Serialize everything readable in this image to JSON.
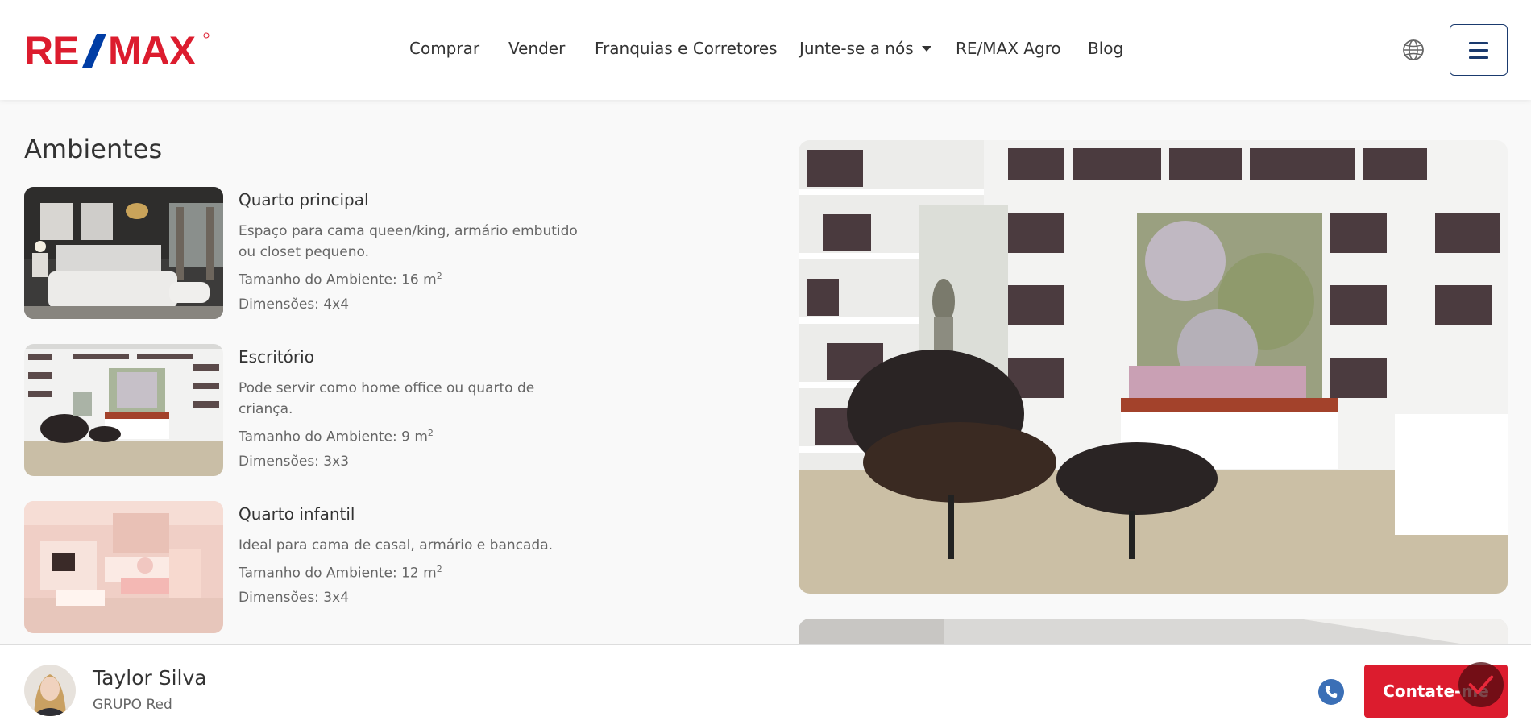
{
  "brand": {
    "logo_text": "RE/MAX",
    "red": "#dc1c2e",
    "blue": "#003da5"
  },
  "nav": {
    "items": [
      {
        "label": "Comprar"
      },
      {
        "label": "Vender"
      },
      {
        "label": "Franquias e Corretores"
      },
      {
        "label": "Junte-se a nós",
        "dropdown": true
      },
      {
        "label": "RE/MAX Agro"
      },
      {
        "label": "Blog"
      }
    ],
    "globe_icon": "globe-icon",
    "menu_icon": "hamburger-menu-icon"
  },
  "section": {
    "title": "Ambientes",
    "rooms": [
      {
        "name": "Quarto principal",
        "description": "Espaço para cama queen/king, armário embutido ou closet pequeno.",
        "size_label": "Tamanho do Ambiente: 16 m",
        "size_exp": "2",
        "dimensions": "Dimensões: 4x4"
      },
      {
        "name": "Escritório",
        "description": "Pode servir como home office ou quarto de criança.",
        "size_label": "Tamanho do Ambiente: 9 m",
        "size_exp": "2",
        "dimensions": "Dimensões: 3x3"
      },
      {
        "name": "Quarto infantil",
        "description": "Ideal para cama de casal, armário e bancada.",
        "size_label": "Tamanho do Ambiente: 12 m",
        "size_exp": "2",
        "dimensions": "Dimensões: 3x4"
      }
    ]
  },
  "agent": {
    "name": "Taylor Silva",
    "group": "GRUPO Red",
    "phone_icon": "phone-icon",
    "contact_label": "Contate-me"
  }
}
